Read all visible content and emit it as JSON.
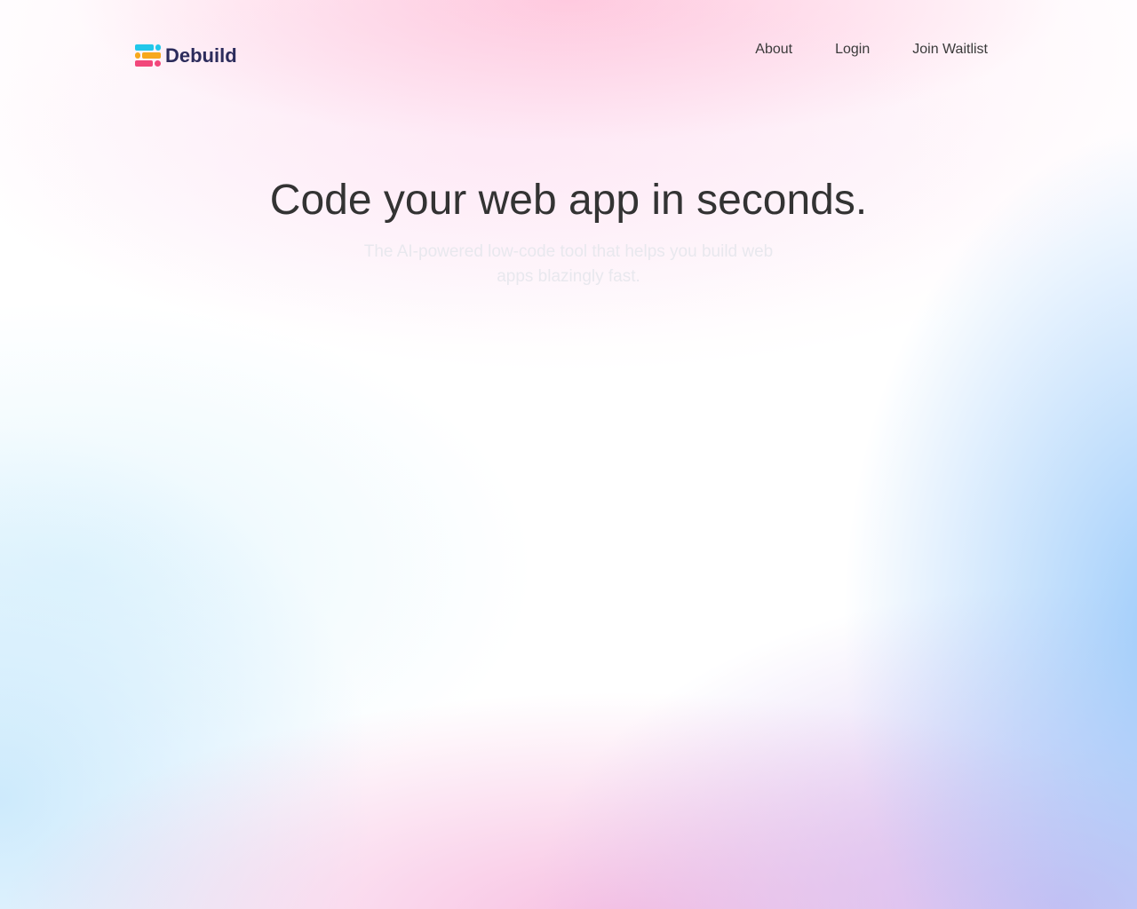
{
  "brand": {
    "name": "Debuild",
    "logo_icon": "debuild-logo-icon",
    "logo_colors": [
      "#22c7ea",
      "#f7a81c",
      "#f2477b"
    ]
  },
  "nav": {
    "items": [
      {
        "label": "About"
      },
      {
        "label": "Login"
      },
      {
        "label": "Join Waitlist"
      }
    ]
  },
  "hero": {
    "title": "Code your web app in seconds.",
    "subtitle": "The AI-powered low-code tool that helps you build web apps blazingly fast."
  },
  "colors": {
    "brand_text": "#2c2c5c",
    "title_text": "#333333",
    "nav_text": "#3a3a3a"
  }
}
